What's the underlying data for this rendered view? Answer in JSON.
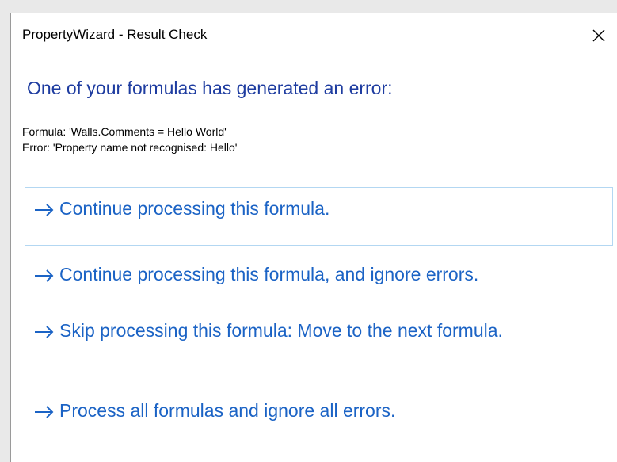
{
  "window": {
    "title": "PropertyWizard - Result Check",
    "close_icon": "close-icon"
  },
  "instruction": "One of your formulas has generated an error:",
  "details": {
    "formula_line": "Formula: 'Walls.Comments = Hello World'",
    "error_line": "Error: 'Property name not recognised: Hello'"
  },
  "commands": [
    {
      "label": "Continue processing this formula.",
      "icon": "arrow-right-icon"
    },
    {
      "label": "Continue processing this formula, and ignore errors.",
      "icon": "arrow-right-icon"
    },
    {
      "label": "Skip processing this formula: Move to the next formula.",
      "icon": "arrow-right-icon"
    },
    {
      "label": "Process all formulas and ignore all errors.",
      "icon": "arrow-right-icon"
    }
  ],
  "colors": {
    "instruction": "#1e3ca0",
    "command_link": "#1b63c5",
    "hover_border": "#b3d7f2"
  }
}
